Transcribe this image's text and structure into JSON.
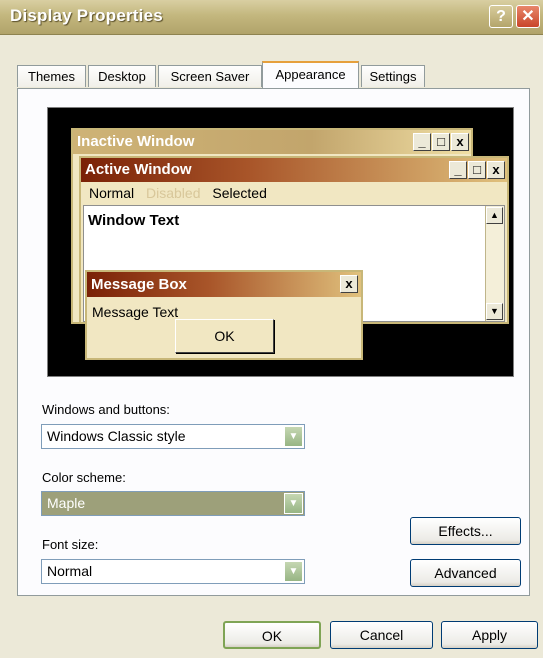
{
  "window": {
    "title": "Display Properties",
    "help": "?",
    "close": "✕"
  },
  "tabs": [
    "Themes",
    "Desktop",
    "Screen Saver",
    "Appearance",
    "Settings"
  ],
  "preview": {
    "inactive_title": "Inactive Window",
    "active_title": "Active Window",
    "menu": {
      "normal": "Normal",
      "disabled": "Disabled",
      "selected": "Selected"
    },
    "window_text": "Window Text",
    "message_box_title": "Message Box",
    "message_text": "Message Text",
    "ok": "OK",
    "win_buttons": {
      "min": "_",
      "max": "□",
      "close": "x"
    }
  },
  "form": {
    "windows_buttons_label": "Windows and buttons:",
    "windows_buttons_value": "Windows Classic style",
    "color_scheme_label": "Color scheme:",
    "color_scheme_value": "Maple",
    "font_size_label": "Font size:",
    "font_size_value": "Normal",
    "effects": "Effects...",
    "advanced": "Advanced"
  },
  "footer": {
    "ok": "OK",
    "cancel": "Cancel",
    "apply": "Apply"
  }
}
